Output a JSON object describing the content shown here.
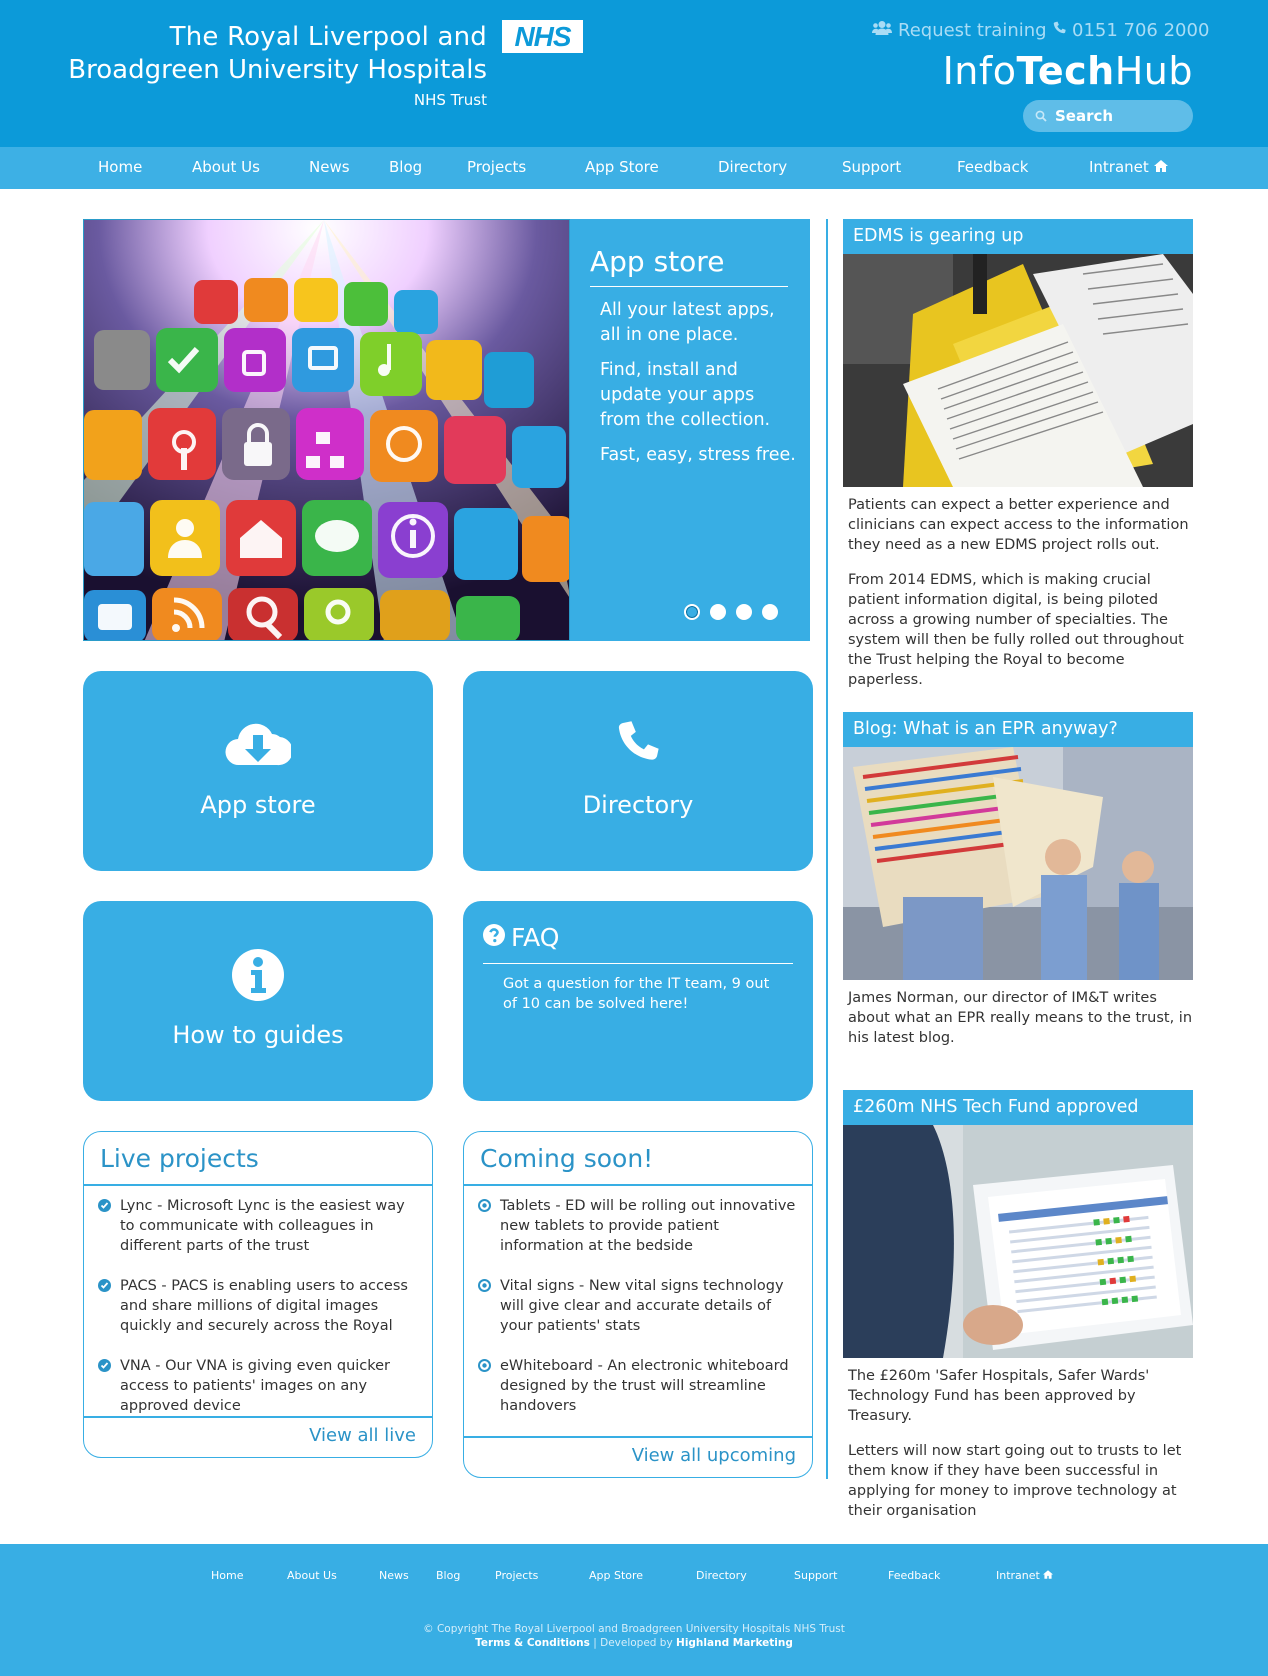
{
  "header": {
    "org_line1": "The Royal Liverpool and",
    "org_line2": "Broadgreen University Hospitals",
    "org_line3": "NHS Trust",
    "nhs_logo": "NHS",
    "request_training": "Request training",
    "phone": "0151 706 2000",
    "hub_title_a": "Info",
    "hub_title_b": "Tech",
    "hub_title_c": "Hub",
    "search_placeholder": "Search"
  },
  "nav": {
    "items": [
      "Home",
      "About Us",
      "News",
      "Blog",
      "Projects",
      "App Store",
      "Directory",
      "Support",
      "Feedback",
      "Intranet"
    ]
  },
  "slider": {
    "title": "App store",
    "para1": "All your latest apps, all in one place.",
    "para2": "Find, install and update your apps from the collection.",
    "para3": "Fast, easy, stress free.",
    "slide_count": 4,
    "active_slide": 1
  },
  "tiles": {
    "app_store": "App store",
    "directory": "Directory",
    "how_to": "How to guides",
    "faq_title": "FAQ",
    "faq_text": "Got a question for the IT team, 9 out of 10 can be solved here!"
  },
  "live_projects": {
    "title": "Live projects",
    "items": [
      "Lync - Microsoft Lync is the easiest way to communicate with colleagues in different parts of the trust",
      "PACS - PACS is enabling users to access and share millions of digital images quickly and securely across the Royal",
      "VNA - Our VNA is giving even quicker access to patients' images on any approved device"
    ],
    "link": "View all live"
  },
  "coming_soon": {
    "title": "Coming soon!",
    "items": [
      "Tablets - ED will be rolling out innovative new tablets to provide patient information at the bedside",
      "Vital signs - New vital signs technology will give clear and accurate details of your patients' stats",
      "eWhiteboard - An electronic whiteboard designed by the trust will streamline handovers"
    ],
    "link": "View all upcoming"
  },
  "news": [
    {
      "title": "EDMS is gearing up",
      "paras": [
        "Patients can expect a better experience and clinicians can expect access to the information they need as a new EDMS project rolls out.",
        "From 2014 EDMS, which is making crucial patient information digital, is being piloted across a growing number of specialties. The system will then be fully rolled out throughout the Trust helping the Royal to become paperless."
      ]
    },
    {
      "title": "Blog: What is an EPR anyway?",
      "paras": [
        "James Norman, our director of IM&T writes about what an EPR really means to the trust, in his latest blog."
      ]
    },
    {
      "title": "£260m NHS Tech Fund approved",
      "paras": [
        "The £260m 'Safer Hospitals, Safer Wards' Technology Fund has been approved by Treasury.",
        "Letters will now start going out to trusts to let them know if they have been successful in applying for money to improve technology at their organisation"
      ]
    }
  ],
  "footer": {
    "nav": [
      "Home",
      "About Us",
      "News",
      "Blog",
      "Projects",
      "App Store",
      "Directory",
      "Support",
      "Feedback",
      "Intranet"
    ],
    "copyright": "© Copyright The Royal Liverpool and Broadgreen University Hospitals NHS Trust",
    "terms": "Terms & Conditions",
    "developed_by": "Developed by",
    "developer": "Highland Marketing"
  },
  "colors": {
    "header_bg": "#0c9ad9",
    "nav_bg": "#3db0e5",
    "tile_bg": "#38aee4",
    "link_blue": "#2b93c7"
  },
  "icons": [
    "users-icon",
    "phone-icon",
    "search-icon",
    "home-icon",
    "cloud-download-icon",
    "phone-icon",
    "info-icon",
    "question-circle-icon",
    "check-circle-icon",
    "dot-circle-icon"
  ]
}
